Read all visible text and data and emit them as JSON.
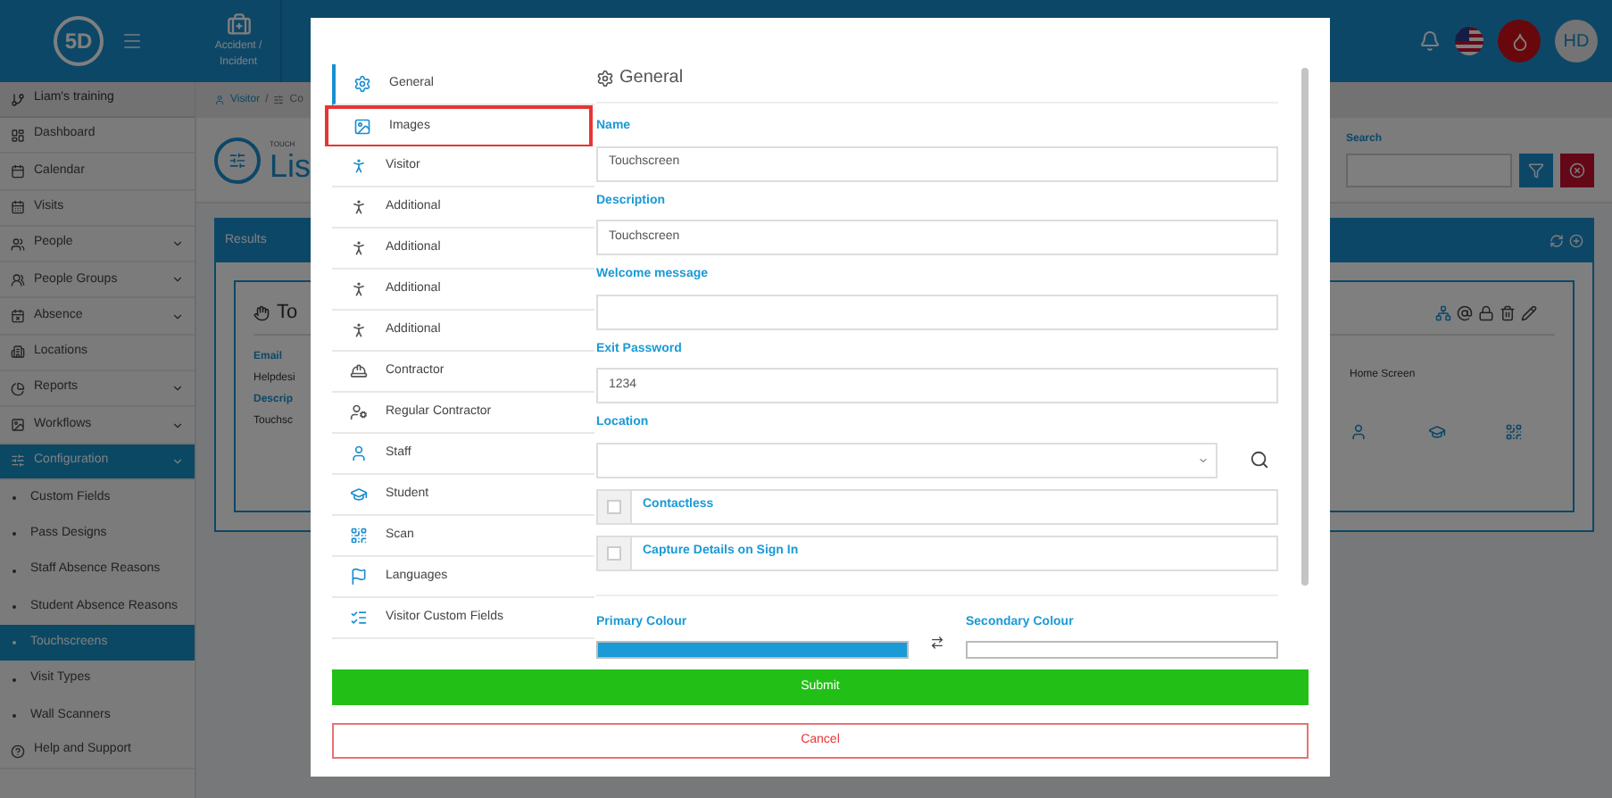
{
  "top_bar": {
    "logo": "5D",
    "tiles": [
      {
        "label": "Accident / Incident"
      }
    ],
    "avatar": "HD"
  },
  "sidebar": {
    "workspace": "Liam's training",
    "items": [
      {
        "label": "Dashboard",
        "expandable": false,
        "selected": false
      },
      {
        "label": "Calendar",
        "expandable": false,
        "selected": false
      },
      {
        "label": "Visits",
        "expandable": false,
        "selected": false
      },
      {
        "label": "People",
        "expandable": true,
        "selected": false
      },
      {
        "label": "People Groups",
        "expandable": true,
        "selected": false
      },
      {
        "label": "Absence",
        "expandable": true,
        "selected": false
      },
      {
        "label": "Locations",
        "expandable": false,
        "selected": false
      },
      {
        "label": "Reports",
        "expandable": true,
        "selected": false
      },
      {
        "label": "Workflows",
        "expandable": true,
        "selected": false
      },
      {
        "label": "Configuration",
        "expandable": true,
        "selected": true,
        "children": [
          {
            "label": "Custom Fields",
            "selected": false
          },
          {
            "label": "Pass Designs",
            "selected": false
          },
          {
            "label": "Staff Absence Reasons",
            "selected": false
          },
          {
            "label": "Student Absence Reasons",
            "selected": false
          },
          {
            "label": "Touchscreens",
            "selected": true
          },
          {
            "label": "Visit Types",
            "selected": false
          },
          {
            "label": "Wall Scanners",
            "selected": false
          }
        ]
      },
      {
        "label": "Help and Support",
        "expandable": false,
        "selected": false
      }
    ]
  },
  "page": {
    "breadcrumb": [
      "Visitor",
      "/",
      "Co"
    ],
    "subtitle": "TOUCH",
    "title": "Lis",
    "search_label": "Search",
    "panel_title": "Results",
    "card_title": "To",
    "card_fields": [
      {
        "label": "Email",
        "value": "Helpdesi"
      },
      {
        "label": "Descrip",
        "value": "Touchsc"
      }
    ],
    "column_4": "Home Screen"
  },
  "modal": {
    "menu": [
      {
        "label": "General",
        "selected": true,
        "highlighted": false,
        "enabled": true
      },
      {
        "label": "Images",
        "selected": false,
        "highlighted": true,
        "enabled": true
      },
      {
        "label": "Visitor",
        "selected": false,
        "highlighted": false,
        "enabled": true
      },
      {
        "label": "Additional",
        "selected": false,
        "highlighted": false,
        "enabled": false
      },
      {
        "label": "Additional",
        "selected": false,
        "highlighted": false,
        "enabled": false
      },
      {
        "label": "Additional",
        "selected": false,
        "highlighted": false,
        "enabled": false
      },
      {
        "label": "Additional",
        "selected": false,
        "highlighted": false,
        "enabled": false
      },
      {
        "label": "Contractor",
        "selected": false,
        "highlighted": false,
        "enabled": false
      },
      {
        "label": "Regular Contractor",
        "selected": false,
        "highlighted": false,
        "enabled": false
      },
      {
        "label": "Staff",
        "selected": false,
        "highlighted": false,
        "enabled": true
      },
      {
        "label": "Student",
        "selected": false,
        "highlighted": false,
        "enabled": true
      },
      {
        "label": "Scan",
        "selected": false,
        "highlighted": false,
        "enabled": true
      },
      {
        "label": "Languages",
        "selected": false,
        "highlighted": false,
        "enabled": true
      },
      {
        "label": "Visitor Custom Fields",
        "selected": false,
        "highlighted": false,
        "enabled": true
      }
    ],
    "heading": "General",
    "fields": [
      {
        "kind": "text",
        "label": "Name",
        "value": "Touchscreen"
      },
      {
        "kind": "text",
        "label": "Description",
        "value": "Touchscreen"
      },
      {
        "kind": "text",
        "label": "Welcome message"
      },
      {
        "kind": "text",
        "label": "Exit Password",
        "value": "1234"
      },
      {
        "kind": "select",
        "label": "Location"
      },
      {
        "kind": "checkbox",
        "label": "Contactless",
        "checked": false
      },
      {
        "kind": "checkbox",
        "label": "Capture Details on Sign In",
        "checked": false
      }
    ],
    "colours": [
      {
        "label": "Primary Colour",
        "color": "#1a9ad6"
      },
      {
        "label": "Secondary Colour",
        "color": "#ffffff"
      }
    ],
    "submit": "Submit",
    "cancel": "Cancel"
  }
}
